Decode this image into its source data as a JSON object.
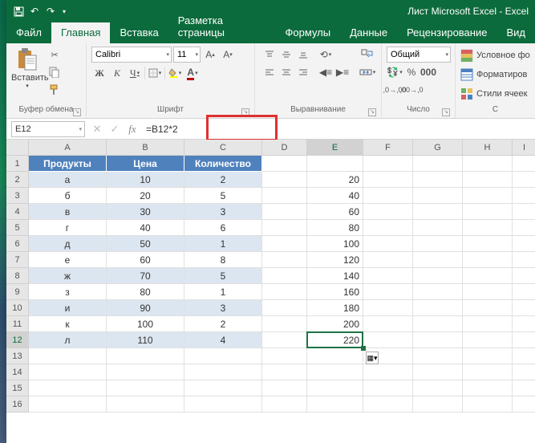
{
  "title": "Лист Microsoft Excel - Excel",
  "tabs": {
    "file": "Файл",
    "home": "Главная",
    "insert": "Вставка",
    "layout": "Разметка страницы",
    "formulas": "Формулы",
    "data": "Данные",
    "review": "Рецензирование",
    "view": "Вид"
  },
  "ribbon": {
    "paste_label": "Вставить",
    "clipboard_group": "Буфер обмена",
    "font_group": "Шрифт",
    "align_group": "Выравнивание",
    "number_group": "Число",
    "styles_group": "С",
    "font_name": "Calibri",
    "font_size": "11",
    "number_format": "Общий",
    "cond_fmt": "Условное фо",
    "fmt_table": "Форматиров",
    "cell_styles": "Стили ячеек"
  },
  "formula": {
    "namebox": "E12",
    "value": "=B12*2"
  },
  "columns": [
    "A",
    "B",
    "C",
    "D",
    "E",
    "F",
    "G",
    "H",
    "I"
  ],
  "headers": {
    "a": "Продукты",
    "b": "Цена",
    "c": "Количество"
  },
  "rows": [
    {
      "n": "1"
    },
    {
      "n": "2",
      "a": "а",
      "b": "10",
      "c": "2",
      "e": "20"
    },
    {
      "n": "3",
      "a": "б",
      "b": "20",
      "c": "5",
      "e": "40"
    },
    {
      "n": "4",
      "a": "в",
      "b": "30",
      "c": "3",
      "e": "60"
    },
    {
      "n": "5",
      "a": "г",
      "b": "40",
      "c": "6",
      "e": "80"
    },
    {
      "n": "6",
      "a": "д",
      "b": "50",
      "c": "1",
      "e": "100"
    },
    {
      "n": "7",
      "a": "е",
      "b": "60",
      "c": "8",
      "e": "120"
    },
    {
      "n": "8",
      "a": "ж",
      "b": "70",
      "c": "5",
      "e": "140"
    },
    {
      "n": "9",
      "a": "з",
      "b": "80",
      "c": "1",
      "e": "160"
    },
    {
      "n": "10",
      "a": "и",
      "b": "90",
      "c": "3",
      "e": "180"
    },
    {
      "n": "11",
      "a": "к",
      "b": "100",
      "c": "2",
      "e": "200"
    },
    {
      "n": "12",
      "a": "л",
      "b": "110",
      "c": "4",
      "e": "220"
    },
    {
      "n": "13"
    },
    {
      "n": "14"
    },
    {
      "n": "15"
    },
    {
      "n": "16"
    }
  ],
  "selected": {
    "row": "12",
    "col": "E"
  }
}
